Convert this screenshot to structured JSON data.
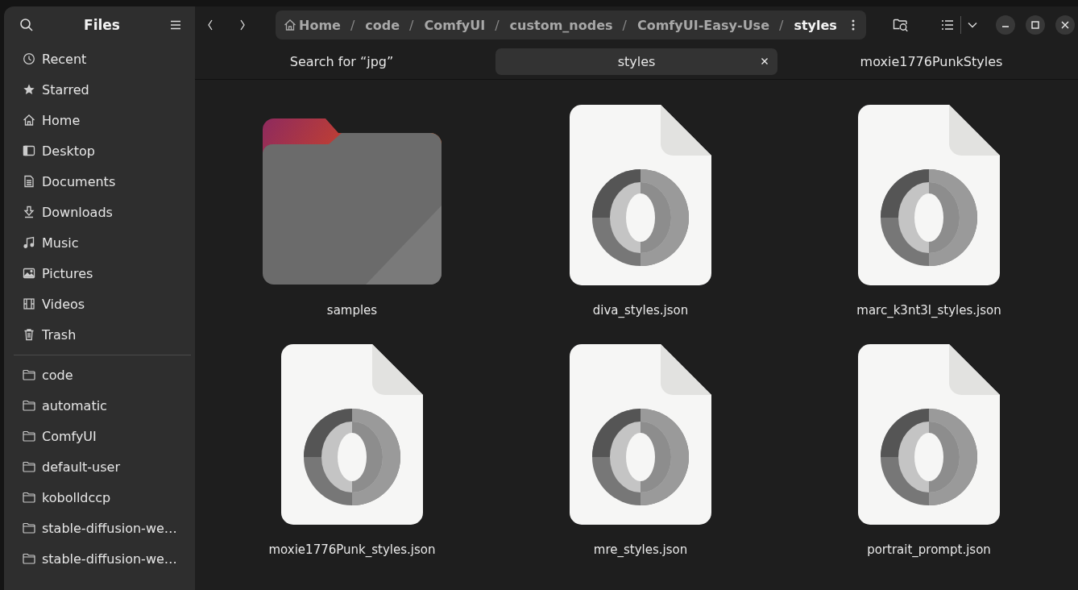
{
  "sidebar": {
    "title": "Files",
    "places": [
      {
        "label": "Recent",
        "kind": "recent"
      },
      {
        "label": "Starred",
        "kind": "starred"
      },
      {
        "label": "Home",
        "kind": "home"
      },
      {
        "label": "Desktop",
        "kind": "desktop"
      },
      {
        "label": "Documents",
        "kind": "documents"
      },
      {
        "label": "Downloads",
        "kind": "downloads"
      },
      {
        "label": "Music",
        "kind": "music"
      },
      {
        "label": "Pictures",
        "kind": "pictures"
      },
      {
        "label": "Videos",
        "kind": "videos"
      },
      {
        "label": "Trash",
        "kind": "trash"
      }
    ],
    "bookmarks": [
      {
        "label": "code"
      },
      {
        "label": "automatic"
      },
      {
        "label": "ComfyUI"
      },
      {
        "label": "default-user"
      },
      {
        "label": "kobolldccp"
      },
      {
        "label": "stable-diffusion-we…"
      },
      {
        "label": "stable-diffusion-we…"
      }
    ]
  },
  "path_bar": {
    "segments": [
      {
        "label": "Home",
        "current": false
      },
      {
        "label": "code",
        "current": false
      },
      {
        "label": "ComfyUI",
        "current": false
      },
      {
        "label": "custom_nodes",
        "current": false
      },
      {
        "label": "ComfyUI-Easy-Use",
        "current": false
      },
      {
        "label": "styles",
        "current": true
      }
    ],
    "separator": "/"
  },
  "tabs": [
    {
      "label": "Search for “jpg”",
      "selected": false
    },
    {
      "label": "styles",
      "selected": true
    },
    {
      "label": "moxie1776PunkStyles",
      "selected": false
    }
  ],
  "files": [
    {
      "name": "samples",
      "kind": "folder"
    },
    {
      "name": "diva_styles.json",
      "kind": "json"
    },
    {
      "name": "marc_k3nt3l_styles.json",
      "kind": "json"
    },
    {
      "name": "moxie1776Punk_styles.json",
      "kind": "json"
    },
    {
      "name": "mre_styles.json",
      "kind": "json"
    },
    {
      "name": "portrait_prompt.json",
      "kind": "json"
    }
  ]
}
